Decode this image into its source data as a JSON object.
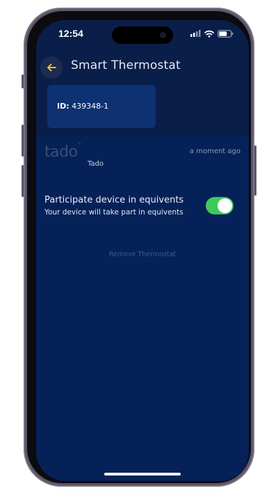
{
  "status_bar": {
    "time": "12:54"
  },
  "header": {
    "title": "Smart Thermostat",
    "back_icon": "arrow-left-icon"
  },
  "device_card": {
    "id_label": "ID:",
    "id_value": "439348-1"
  },
  "device_info": {
    "brand_logo_text": "tado",
    "brand_name": "Tado",
    "last_updated": "a moment ago"
  },
  "setting": {
    "title": "Participate device in equivents",
    "subtitle": "Your device will take part in equivents",
    "enabled": true
  },
  "actions": {
    "remove_label": "Remove Thermostat"
  },
  "colors": {
    "background": "#052158",
    "header": "#0a1e4a",
    "card": "#0d3171",
    "accent": "#f2d243",
    "toggle_on": "#3ccb5a"
  }
}
